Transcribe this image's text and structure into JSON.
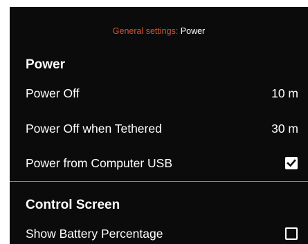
{
  "breadcrumb": {
    "parent": "General settings",
    "separator": ":",
    "current": "Power"
  },
  "sections": [
    {
      "title": "Power",
      "items": [
        {
          "label": "Power Off",
          "value": "10 m"
        },
        {
          "label": "Power Off when Tethered",
          "value": "30 m"
        },
        {
          "label": "Power from Computer USB",
          "checked": true
        }
      ]
    },
    {
      "title": "Control Screen",
      "items": [
        {
          "label": "Show Battery Percentage",
          "checked": false
        }
      ]
    }
  ],
  "colors": {
    "background": "#0b0b0b",
    "accent": "#d8542f",
    "text": "#ffffff",
    "divider": "#8a8a8a"
  },
  "icons": {
    "checked": "checkmark-icon",
    "unchecked": "empty-checkbox-icon"
  }
}
